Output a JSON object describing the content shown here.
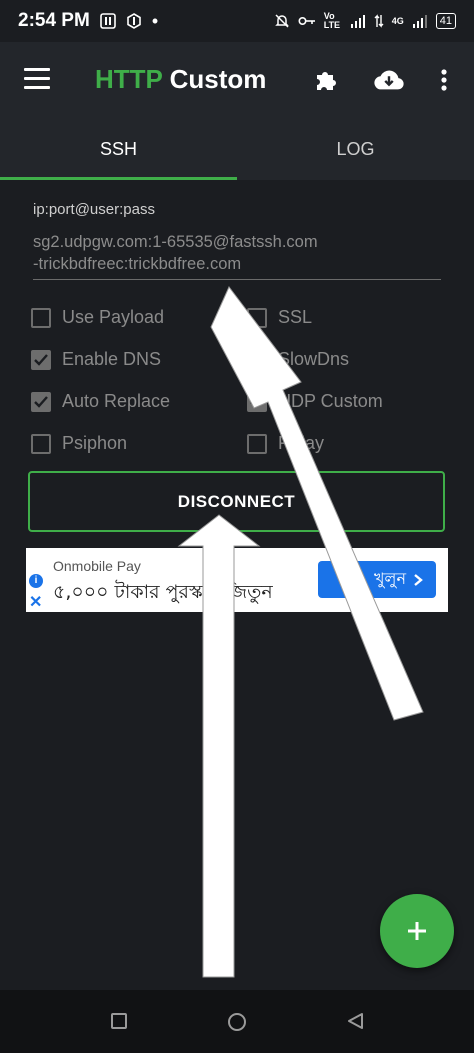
{
  "status_bar": {
    "time": "2:54 PM",
    "network_type": "4G",
    "volte": "Vo LTE",
    "battery": "41"
  },
  "app_bar": {
    "title_part1": "HTTP",
    "title_part2": " Custom",
    "accent_color": "#3fae49"
  },
  "tabs": [
    {
      "label": "SSH",
      "active": true
    },
    {
      "label": "LOG",
      "active": false
    }
  ],
  "ssh": {
    "field_label": "ip:port@user:pass",
    "field_value": "sg2.udpgw.com:1-65535@fastssh.com-trickbdfreec:trickbdfree.com",
    "field_line1": "sg2.udpgw.com:1-65535@fastssh.com",
    "field_line2": "-trickbdfreec:trickbdfree.com"
  },
  "options": [
    {
      "label": "Use Payload",
      "checked": false
    },
    {
      "label": "SSL",
      "checked": false
    },
    {
      "label": "Enable DNS",
      "checked": true
    },
    {
      "label": "SlowDns",
      "checked": false
    },
    {
      "label": "Auto Replace",
      "checked": true
    },
    {
      "label": "UDP Custom",
      "checked": true
    },
    {
      "label": "Psiphon",
      "checked": false
    },
    {
      "label": "Relay",
      "checked": false
    }
  ],
  "actions": {
    "disconnect_label": "DISCONNECT"
  },
  "ad": {
    "sponsor": "Onmobile Pay",
    "headline": "৫,০০০ টাকার পুরস্কার জিতুন",
    "cta": "খুলুন"
  },
  "fab": {
    "icon": "plus-icon"
  }
}
